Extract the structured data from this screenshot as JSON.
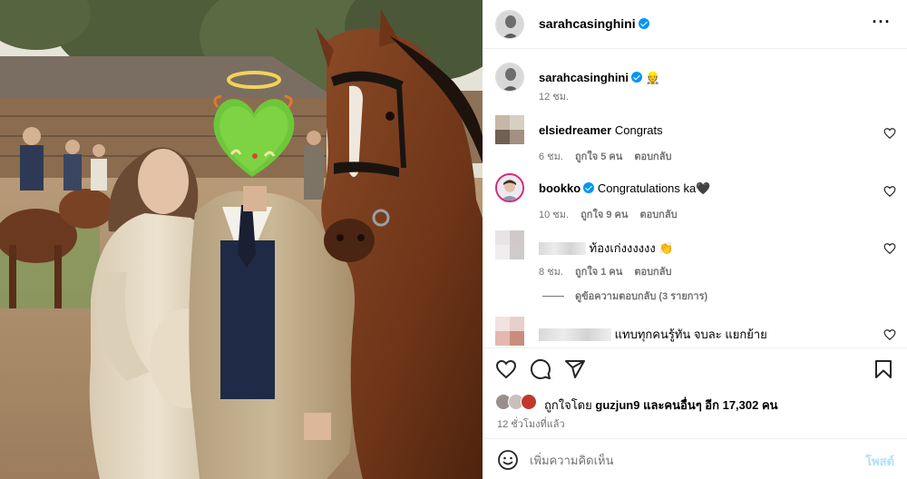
{
  "post": {
    "username": "sarahcasinghini"
  },
  "caption": {
    "username": "sarahcasinghini",
    "emoji": "👷",
    "time": "12 ชม."
  },
  "comments": [
    {
      "username": "elsiedreamer",
      "text": "Congrats",
      "time": "6 ชม.",
      "likes": "ถูกใจ 5 คน",
      "reply": "ตอบกลับ"
    },
    {
      "username": "bookko",
      "text": "Congratulations ka",
      "emoji": "🖤",
      "time": "10 ชม.",
      "likes": "ถูกใจ 9 คน",
      "reply": "ตอบกลับ"
    },
    {
      "username": "",
      "text": "ท้องเก่งงงงงง",
      "emoji": "👏",
      "time": "8 ชม.",
      "likes": "ถูกใจ 1 คน",
      "reply": "ตอบกลับ"
    },
    {
      "username": "",
      "text": "แทบทุกคนรู้ทัน จบละ แยกย้าย"
    }
  ],
  "view_replies": "ดูข้อความตอบกลับ (3 รายการ)",
  "likes": {
    "prefix": "ถูกใจโดย",
    "user": "guzjun9",
    "suffix": "และคนอื่นๆ อีก 17,302 คน"
  },
  "time_ago": "12 ชั่วโมงที่แล้ว",
  "comment_box": {
    "placeholder": "เพิ่มความคิดเห็น",
    "post_label": "โพสต์"
  },
  "colors": {
    "accent": "#0095f6",
    "post_button_disabled": "#b2dffc",
    "secondary_text": "#737373"
  }
}
